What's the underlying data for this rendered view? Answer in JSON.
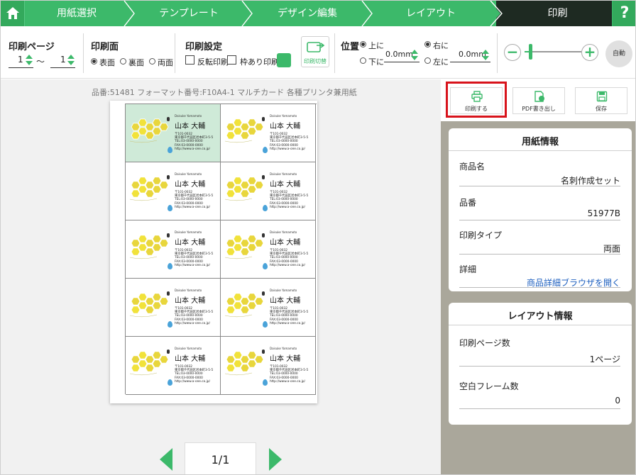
{
  "nav": {
    "steps": [
      "用紙選択",
      "テンプレート",
      "デザイン編集",
      "レイアウト",
      "印刷"
    ],
    "active": "印刷",
    "help": "?"
  },
  "toolbar": {
    "page_label": "印刷ページ",
    "page_from": "1",
    "page_tilde": "〜",
    "page_to": "1",
    "side_label": "印刷面",
    "side_options": [
      "表面",
      "裏面",
      "両面"
    ],
    "side_selected": "表面",
    "settings_label": "印刷設定",
    "reverse_label": "反転印刷",
    "frame_label": "枠あり印刷",
    "switch_label": "印刷切替",
    "position_label": "位置",
    "pos_up": "上に",
    "pos_down": "下に",
    "pos_v_value": "0.0mm",
    "pos_right": "右に",
    "pos_left": "左に",
    "pos_h_value": "0.0mm",
    "auto_label": "自動",
    "zoom_level": 0.1
  },
  "canvas": {
    "product_line": "品番:51481 フォーマット番号:F10A4-1 マルチカード 各種プリンタ兼用紙",
    "card": {
      "english_name": "Daisuke Yamamoto",
      "name": "山本 大輔",
      "address_lines": [
        "〒101-0032",
        "東京都千代田区岩本町3-5-5",
        "TEL:03-0000-0000",
        "FAX:03-0000-0000",
        "http://www.a-one.co.jp/"
      ]
    },
    "card_count": 10,
    "selected_index": 0,
    "page": "1/1"
  },
  "actions": {
    "print": "印刷する",
    "pdf": "PDF書き出し",
    "save": "保存"
  },
  "paper_info": {
    "title": "用紙情報",
    "rows": [
      {
        "label": "商品名",
        "value": "名刺作成セット"
      },
      {
        "label": "品番",
        "value": "51977B"
      },
      {
        "label": "印刷タイプ",
        "value": "両面"
      },
      {
        "label": "詳細",
        "value": "商品詳細ブラウザを開く"
      }
    ]
  },
  "layout_info": {
    "title": "レイアウト情報",
    "rows": [
      {
        "label": "印刷ページ数",
        "value": "1ページ"
      },
      {
        "label": "空白フレーム数",
        "value": "0"
      }
    ]
  },
  "colors": {
    "accent": "#3cb96a",
    "highlight": "#d8131b",
    "panel_bg": "#aaa79b"
  }
}
